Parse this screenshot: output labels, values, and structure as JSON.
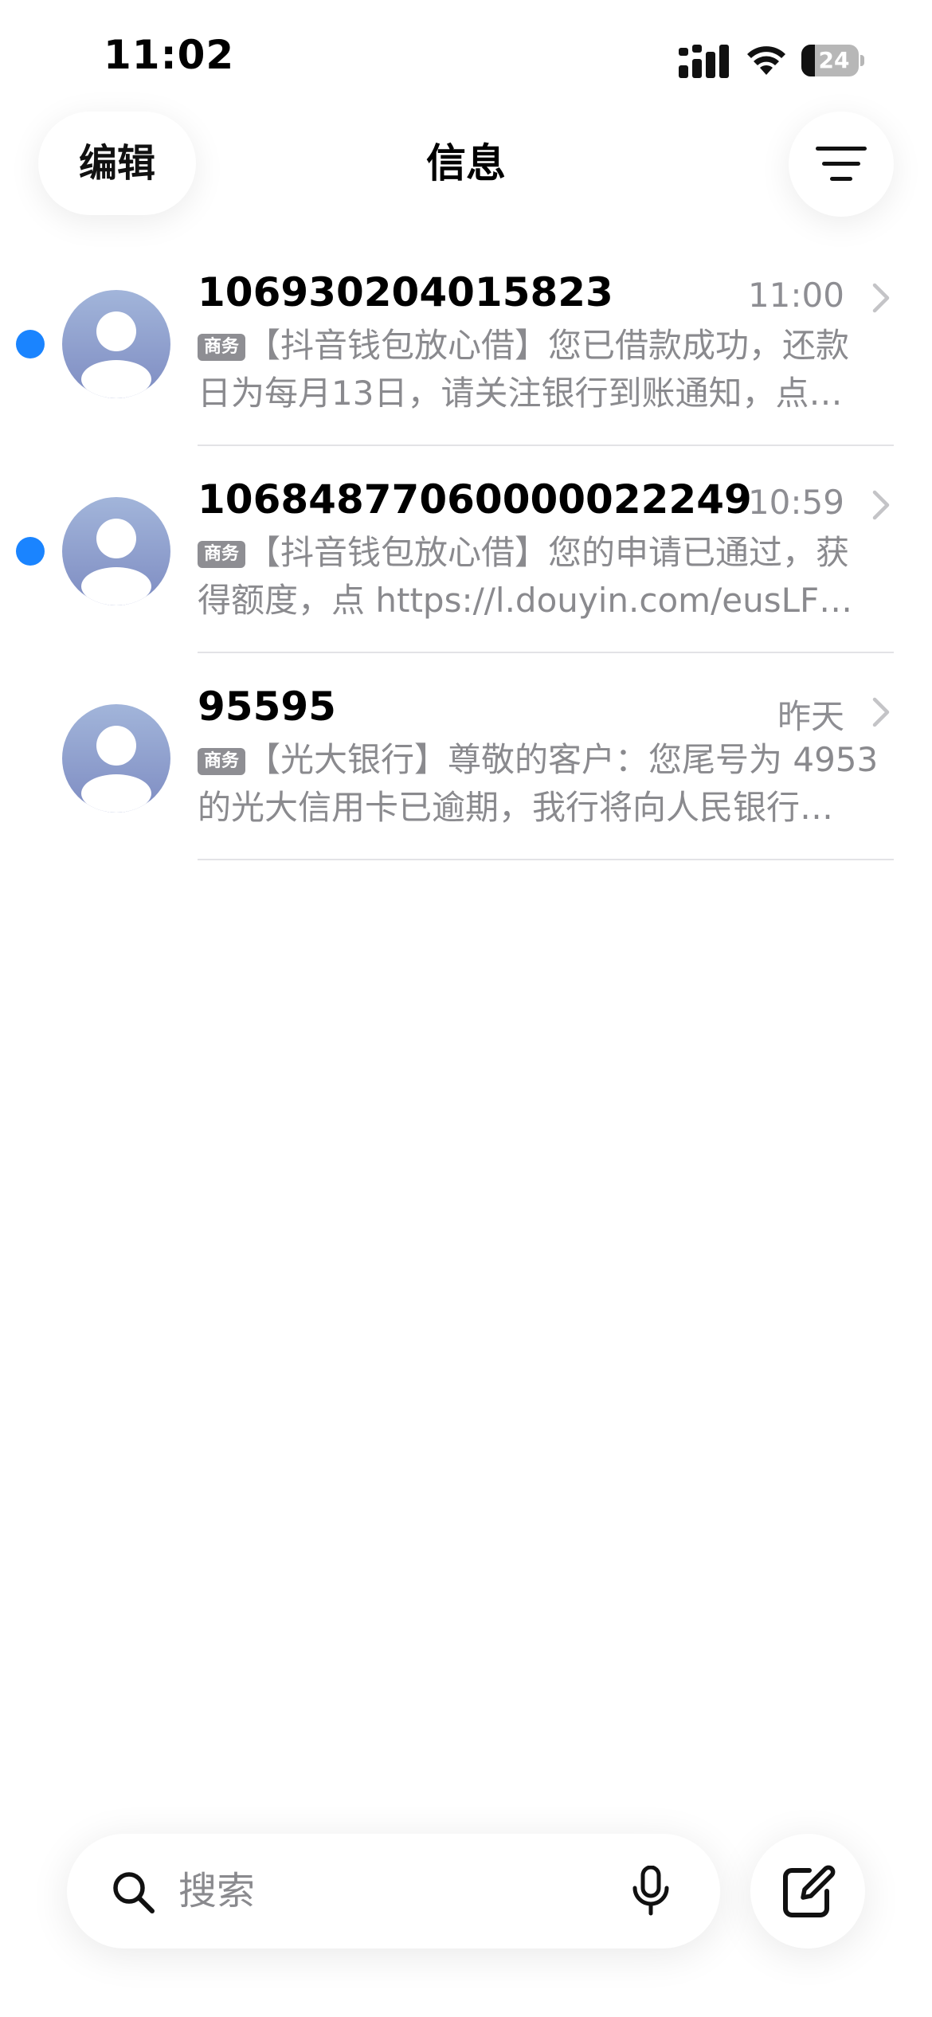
{
  "status_bar": {
    "time": "11:02",
    "battery_level": "24",
    "icons": [
      "signal-icon",
      "wifi-icon",
      "battery-icon"
    ]
  },
  "nav": {
    "edit_label": "编辑",
    "title": "信息",
    "filter_icon": "filter-lines-icon"
  },
  "conversations": [
    {
      "sender": "106930204015823",
      "time": "11:00",
      "unread": true,
      "tag": "商务",
      "preview_line1": "【抖音钱包放心借】您已借款成功，还款",
      "preview_line2": "日为每月13日，请关注银行到账通知，点…"
    },
    {
      "sender": "10684877060000022249",
      "time": "10:59",
      "unread": true,
      "tag": "商务",
      "preview_line1": "【抖音钱包放心借】您的申请已通过，获",
      "preview_line2": "得额度，点 https://l.douyin.com/eusLF…"
    },
    {
      "sender": "95595",
      "time": "昨天",
      "unread": false,
      "tag": "商务",
      "preview_line1": "【光大银行】尊敬的客户：您尾号为 4953",
      "preview_line2": "的光大信用卡已逾期，我行将向人民银行…"
    }
  ],
  "bottom": {
    "search_placeholder": "搜索",
    "icons": [
      "search-icon",
      "microphone-icon",
      "compose-icon"
    ]
  },
  "colors": {
    "unread_dot": "#1a84ff",
    "secondary_text": "#8a8a8e",
    "tag_badge": "#8e8e93",
    "avatar_gradient_top": "#a2b5da",
    "avatar_gradient_bottom": "#7e8cc2"
  }
}
